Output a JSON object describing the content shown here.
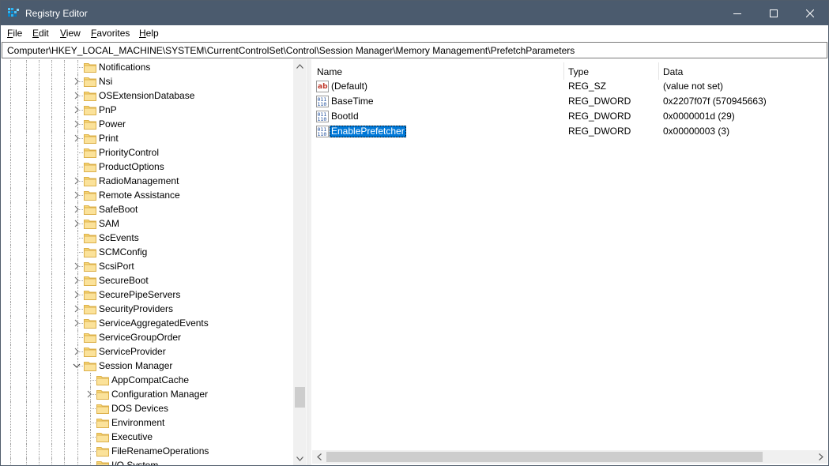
{
  "window": {
    "title": "Registry Editor",
    "controls": {
      "minimize": "minimize",
      "maximize": "maximize",
      "close": "close"
    }
  },
  "menu": [
    "File",
    "Edit",
    "View",
    "Favorites",
    "Help"
  ],
  "address": "Computer\\HKEY_LOCAL_MACHINE\\SYSTEM\\CurrentControlSet\\Control\\Session Manager\\Memory Management\\PrefetchParameters",
  "tree": [
    {
      "label": "Notifications",
      "level": 1,
      "chevron": "none"
    },
    {
      "label": "Nsi",
      "level": 1,
      "chevron": "right"
    },
    {
      "label": "OSExtensionDatabase",
      "level": 1,
      "chevron": "right"
    },
    {
      "label": "PnP",
      "level": 1,
      "chevron": "right"
    },
    {
      "label": "Power",
      "level": 1,
      "chevron": "right"
    },
    {
      "label": "Print",
      "level": 1,
      "chevron": "right"
    },
    {
      "label": "PriorityControl",
      "level": 1,
      "chevron": "none"
    },
    {
      "label": "ProductOptions",
      "level": 1,
      "chevron": "none"
    },
    {
      "label": "RadioManagement",
      "level": 1,
      "chevron": "right"
    },
    {
      "label": "Remote Assistance",
      "level": 1,
      "chevron": "right"
    },
    {
      "label": "SafeBoot",
      "level": 1,
      "chevron": "right"
    },
    {
      "label": "SAM",
      "level": 1,
      "chevron": "right"
    },
    {
      "label": "ScEvents",
      "level": 1,
      "chevron": "none"
    },
    {
      "label": "SCMConfig",
      "level": 1,
      "chevron": "none"
    },
    {
      "label": "ScsiPort",
      "level": 1,
      "chevron": "right"
    },
    {
      "label": "SecureBoot",
      "level": 1,
      "chevron": "right"
    },
    {
      "label": "SecurePipeServers",
      "level": 1,
      "chevron": "right"
    },
    {
      "label": "SecurityProviders",
      "level": 1,
      "chevron": "right"
    },
    {
      "label": "ServiceAggregatedEvents",
      "level": 1,
      "chevron": "right"
    },
    {
      "label": "ServiceGroupOrder",
      "level": 1,
      "chevron": "none"
    },
    {
      "label": "ServiceProvider",
      "level": 1,
      "chevron": "right"
    },
    {
      "label": "Session Manager",
      "level": 1,
      "chevron": "down"
    },
    {
      "label": "AppCompatCache",
      "level": 2,
      "chevron": "none"
    },
    {
      "label": "Configuration Manager",
      "level": 2,
      "chevron": "right"
    },
    {
      "label": "DOS Devices",
      "level": 2,
      "chevron": "none"
    },
    {
      "label": "Environment",
      "level": 2,
      "chevron": "none"
    },
    {
      "label": "Executive",
      "level": 2,
      "chevron": "none"
    },
    {
      "label": "FileRenameOperations",
      "level": 2,
      "chevron": "none"
    },
    {
      "label": "I/O System",
      "level": 2,
      "chevron": "none"
    }
  ],
  "columns": {
    "name": "Name",
    "type": "Type",
    "data": "Data"
  },
  "values": [
    {
      "name": "(Default)",
      "type": "REG_SZ",
      "data": "(value not set)",
      "icon": "string-value-icon",
      "selected": false
    },
    {
      "name": "BaseTime",
      "type": "REG_DWORD",
      "data": "0x2207f07f (570945663)",
      "icon": "binary-value-icon",
      "selected": false
    },
    {
      "name": "BootId",
      "type": "REG_DWORD",
      "data": "0x0000001d (29)",
      "icon": "binary-value-icon",
      "selected": false
    },
    {
      "name": "EnablePrefetcher",
      "type": "REG_DWORD",
      "data": "0x00000003 (3)",
      "icon": "binary-value-icon",
      "selected": true
    }
  ],
  "colors": {
    "titlebar": "#4b5b6e",
    "selection": "#0078d7",
    "folder": "#f8d775",
    "folder_edge": "#dcb04a"
  }
}
